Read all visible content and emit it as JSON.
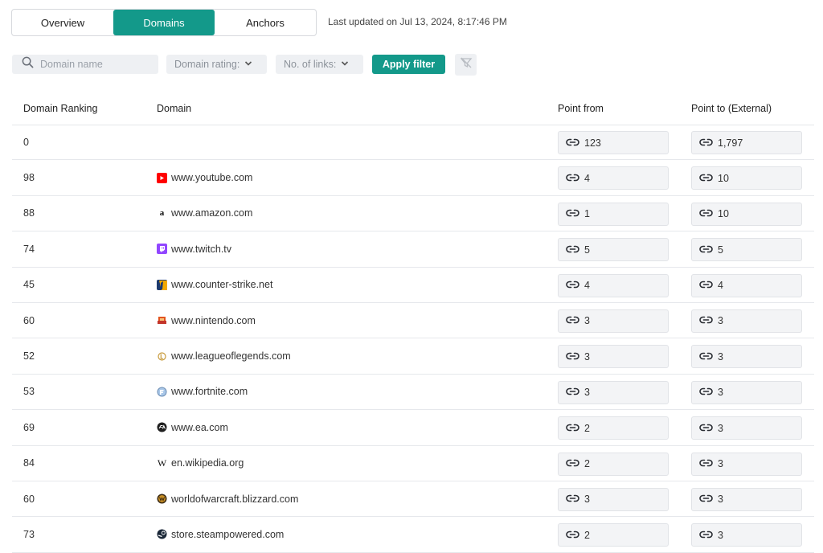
{
  "tabs": [
    {
      "label": "Overview"
    },
    {
      "label": "Domains"
    },
    {
      "label": "Anchors"
    }
  ],
  "last_updated": "Last updated on Jul 13, 2024, 8:17:46 PM",
  "filters": {
    "search_placeholder": "Domain name",
    "domain_rating_label": "Domain rating:",
    "links_label": "No. of links:",
    "apply_label": "Apply filter"
  },
  "columns": {
    "ranking": "Domain Ranking",
    "domain": "Domain",
    "point_from": "Point from",
    "point_to": "Point to (External)"
  },
  "colors": {
    "accent": "#13998a"
  },
  "rows": [
    {
      "rank": "0",
      "domain": "",
      "icon": "none",
      "from": "123",
      "to": "1,797"
    },
    {
      "rank": "98",
      "domain": "www.youtube.com",
      "icon": "youtube-icon",
      "from": "4",
      "to": "10"
    },
    {
      "rank": "88",
      "domain": "www.amazon.com",
      "icon": "amazon-icon",
      "from": "1",
      "to": "10"
    },
    {
      "rank": "74",
      "domain": "www.twitch.tv",
      "icon": "twitch-icon",
      "from": "5",
      "to": "5"
    },
    {
      "rank": "45",
      "domain": "www.counter-strike.net",
      "icon": "counter-strike-icon",
      "from": "4",
      "to": "4"
    },
    {
      "rank": "60",
      "domain": "www.nintendo.com",
      "icon": "nintendo-icon",
      "from": "3",
      "to": "3"
    },
    {
      "rank": "52",
      "domain": "www.leagueoflegends.com",
      "icon": "league-of-legends-icon",
      "from": "3",
      "to": "3"
    },
    {
      "rank": "53",
      "domain": "www.fortnite.com",
      "icon": "fortnite-icon",
      "from": "3",
      "to": "3"
    },
    {
      "rank": "69",
      "domain": "www.ea.com",
      "icon": "ea-icon",
      "from": "2",
      "to": "3"
    },
    {
      "rank": "84",
      "domain": "en.wikipedia.org",
      "icon": "wikipedia-icon",
      "from": "2",
      "to": "3"
    },
    {
      "rank": "60",
      "domain": "worldofwarcraft.blizzard.com",
      "icon": "world-of-warcraft-icon",
      "from": "3",
      "to": "3"
    },
    {
      "rank": "73",
      "domain": "store.steampowered.com",
      "icon": "steam-icon",
      "from": "2",
      "to": "3"
    }
  ]
}
